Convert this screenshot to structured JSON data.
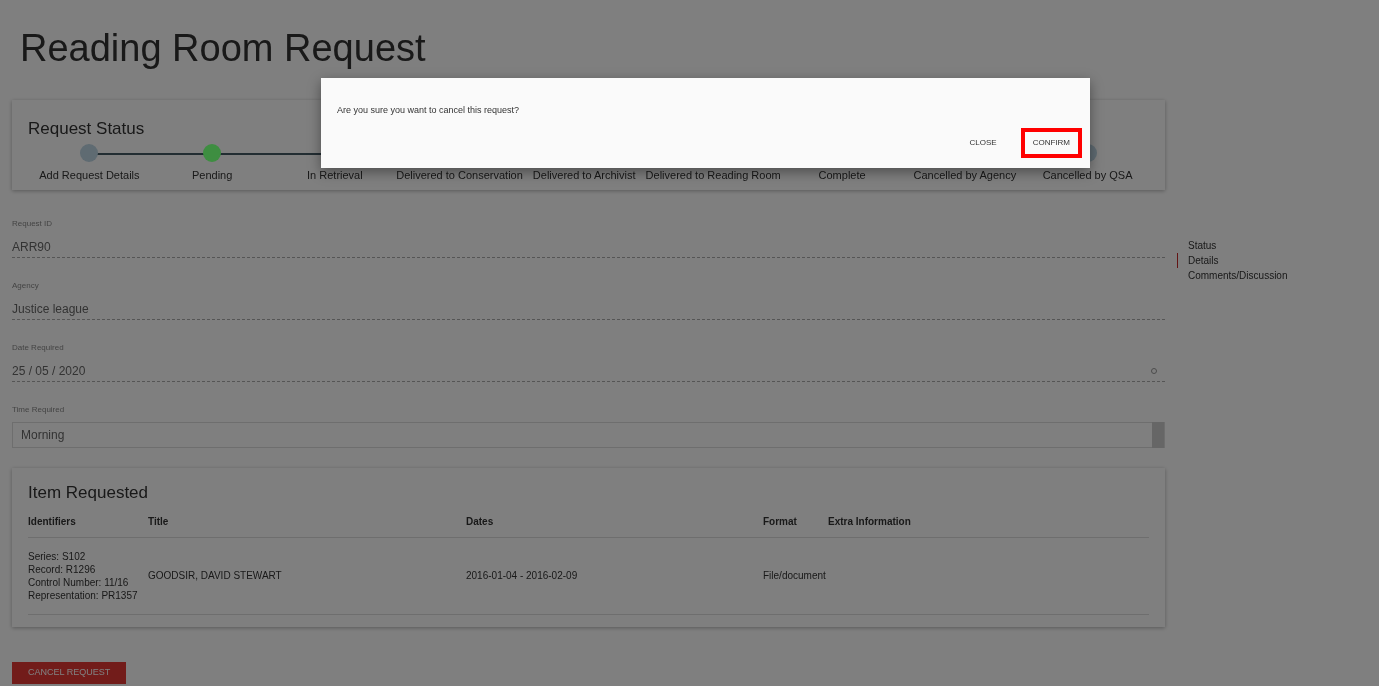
{
  "page": {
    "title": "Reading Room Request"
  },
  "status_card": {
    "title": "Request Status",
    "steps": [
      {
        "label": "Add Request Details",
        "color": "#5f6b72"
      },
      {
        "label": "Pending",
        "color": "#3e8e41"
      },
      {
        "label": "In Retrieval"
      },
      {
        "label": "Delivered to Conservation"
      },
      {
        "label": "Delivered to Archivist"
      },
      {
        "label": "Delivered to Reading Room"
      },
      {
        "label": "Complete"
      },
      {
        "label": "Cancelled by Agency"
      },
      {
        "label": "Cancelled by QSA",
        "color": "#5f6b72"
      }
    ]
  },
  "fields": [
    {
      "kind": "text",
      "label": "Request ID",
      "value": "ARR90"
    },
    {
      "kind": "text",
      "label": "Agency",
      "value": "Justice league"
    },
    {
      "kind": "date",
      "label": "Date Required",
      "value": "25 / 05 / 2020"
    },
    {
      "kind": "select",
      "label": "Time Required",
      "value": "Morning"
    }
  ],
  "side_nav": [
    {
      "label": "Status",
      "selected": false
    },
    {
      "label": "Details",
      "selected": true
    },
    {
      "label": "Comments/Discussion",
      "selected": false
    }
  ],
  "items": {
    "title": "Item Requested",
    "columns": [
      "Identifiers",
      "Title",
      "Dates",
      "Format",
      "Extra Information"
    ],
    "rows": [
      {
        "identifiers": [
          "Series: S102",
          "Record: R1296",
          "Control Number: 11/16",
          "Representation: PR1357"
        ],
        "title": "GOODSIR, DAVID STEWART",
        "dates": "2016-01-04 - 2016-02-09",
        "format": "File/document"
      }
    ]
  },
  "cancel_button": "CANCEL REQUEST",
  "dialog": {
    "message": "Are you sure you want to cancel this request?",
    "buttons": [
      {
        "label": "CLOSE",
        "highlighted": false
      },
      {
        "label": "CONFIRM",
        "highlighted": true
      }
    ]
  }
}
